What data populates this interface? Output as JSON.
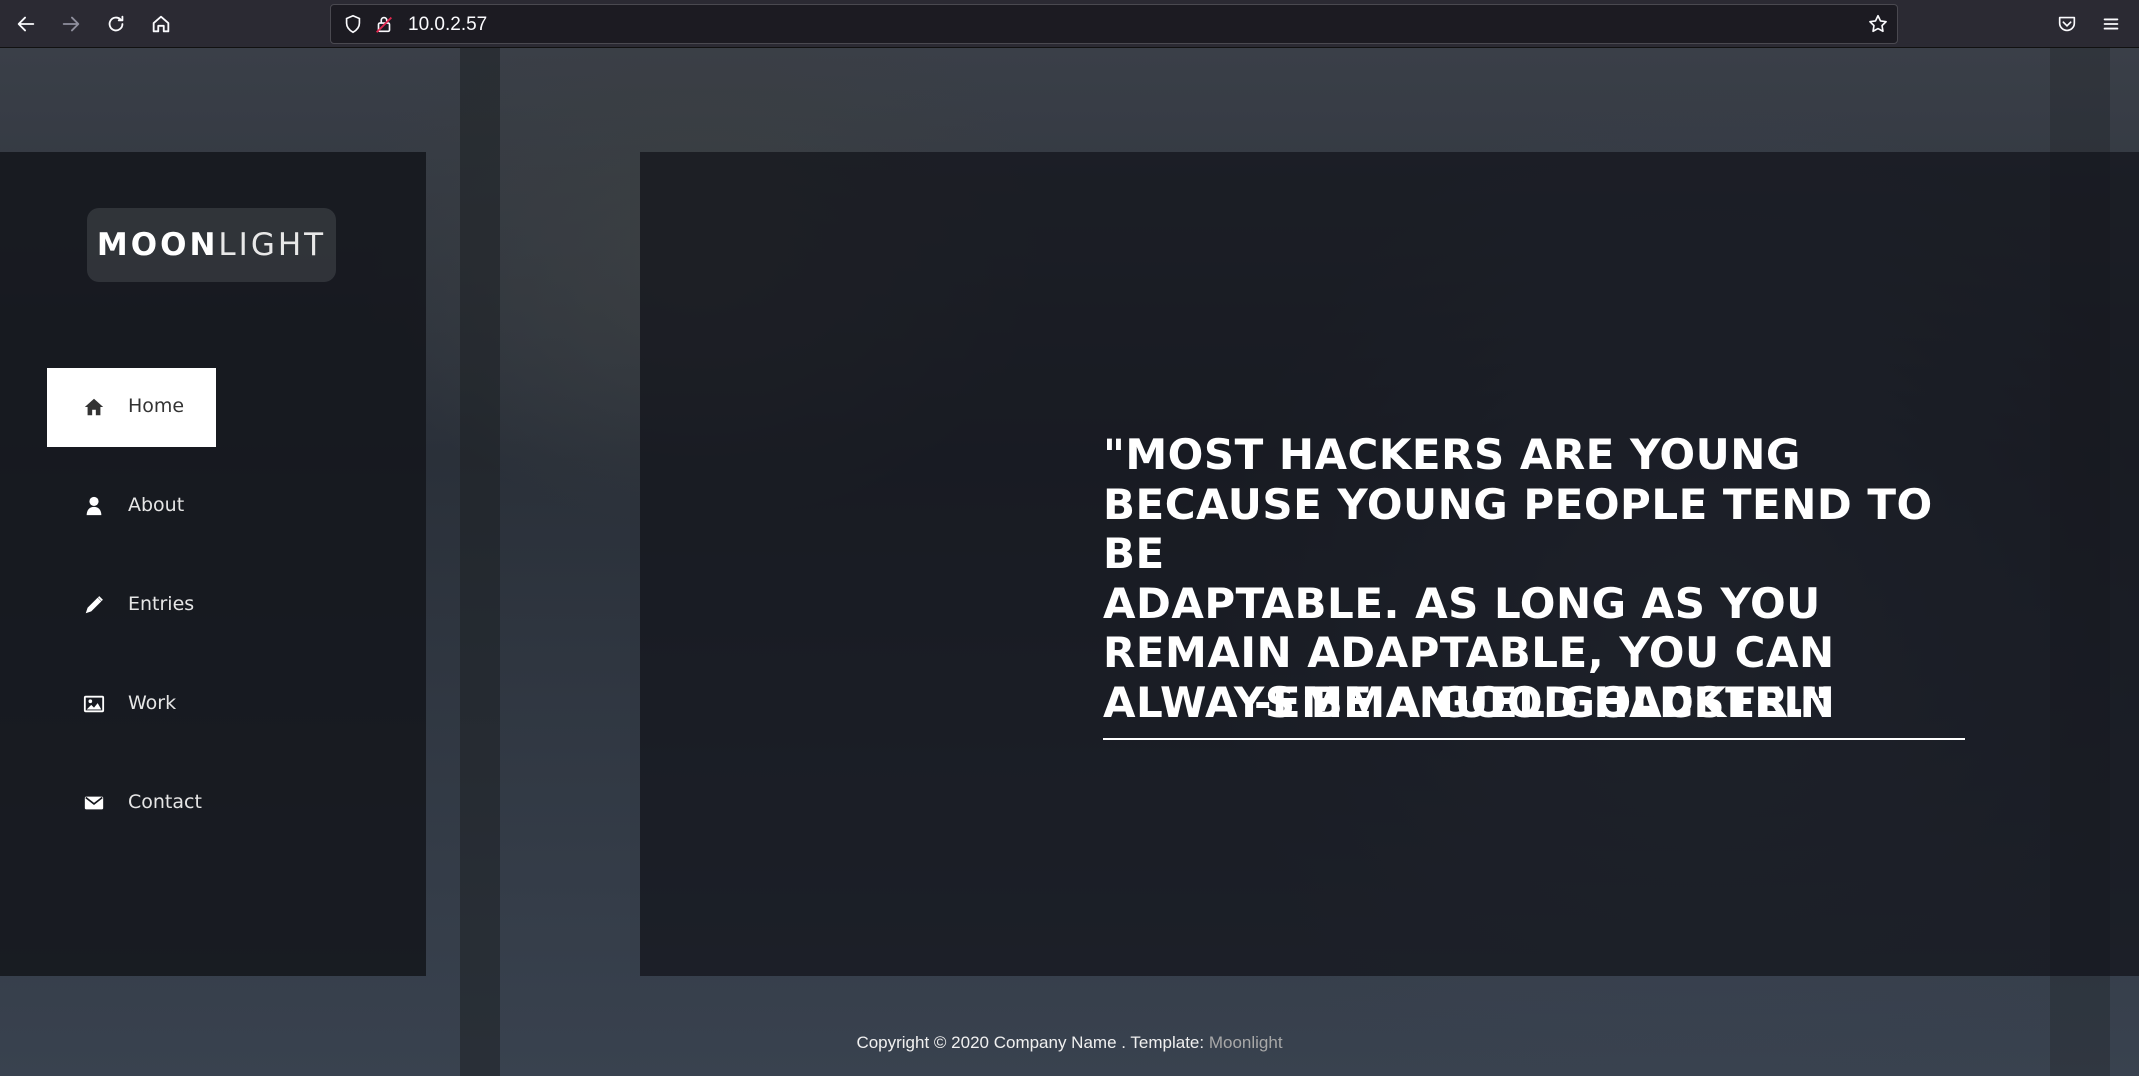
{
  "browser": {
    "url": "10.0.2.57",
    "icons": [
      "back-icon",
      "forward-icon",
      "reload-icon",
      "home-icon",
      "shield-icon",
      "lock-icon",
      "star-icon",
      "pocket-icon",
      "menu-icon"
    ]
  },
  "site": {
    "logo_bold": "MOON",
    "logo_light": "LIGHT",
    "nav": [
      {
        "label": "Home",
        "icon": "home-icon",
        "active": true
      },
      {
        "label": "About",
        "icon": "user-icon",
        "active": false
      },
      {
        "label": "Entries",
        "icon": "pencil-icon",
        "active": false
      },
      {
        "label": "Work",
        "icon": "image-icon",
        "active": false
      },
      {
        "label": "Contact",
        "icon": "envelope-icon",
        "active": false
      }
    ],
    "quote_lines": [
      "\"MOST HACKERS ARE YOUNG",
      "BECAUSE YOUNG PEOPLE TEND TO BE",
      "ADAPTABLE. AS LONG AS YOU",
      "REMAIN ADAPTABLE, YOU CAN",
      "ALWAYS BE A GOOD HACKER.\""
    ],
    "quote_author": "-EMMANUEL GOLDSTEIN",
    "footer_text": "Copyright © 2020 Company Name . Template: ",
    "footer_link": "Moonlight"
  },
  "colors": {
    "chrome_bg": "#2b2a33",
    "sidebar_bg": "#14161c",
    "active_nav_bg": "#ffffff",
    "text": "#ffffff"
  }
}
